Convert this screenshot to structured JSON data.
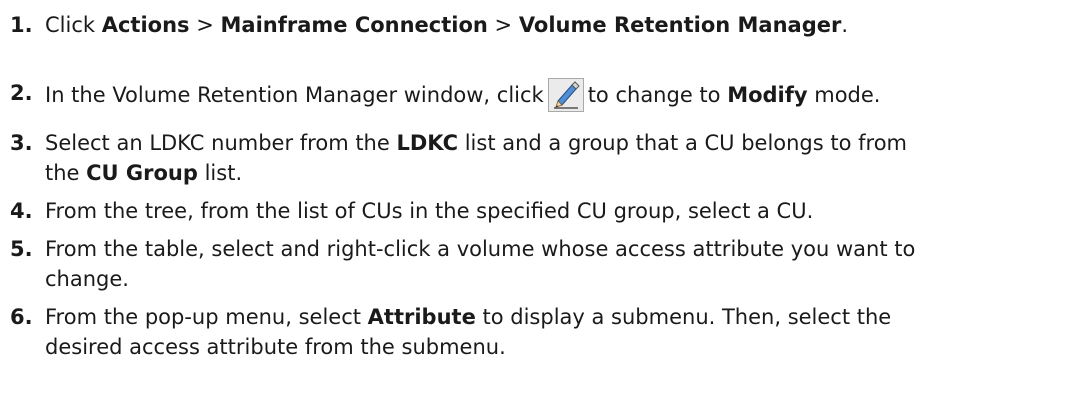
{
  "steps": [
    {
      "number": "1.",
      "parts": [
        "Click ",
        "Actions",
        " > ",
        "Mainframe Connection",
        " > ",
        "Volume Retention Manager",
        "."
      ]
    },
    {
      "number": "2.",
      "before": "In the Volume Retention Manager window, click",
      "after": "to change to ",
      "bold": "Modify",
      "tail": " mode.",
      "icon": "pencil-icon"
    },
    {
      "number": "3.",
      "line1_a": "Select an LDKC number from the ",
      "line1_b": "LDKC",
      "line1_c": " list and a group that a CU belongs to from",
      "line2_a": "the ",
      "line2_b": "CU Group",
      "line2_c": " list."
    },
    {
      "number": "4.",
      "text": "From the tree, from the list of CUs in the specified CU group, select a CU."
    },
    {
      "number": "5.",
      "line1": "From the table, select and right-click a volume whose access attribute you want to",
      "line2": "change."
    },
    {
      "number": "6.",
      "line1_a": "From the pop-up menu, select ",
      "line1_b": "Attribute",
      "line1_c": " to display a submenu. Then, select the",
      "line2": "desired access attribute from the submenu."
    }
  ]
}
